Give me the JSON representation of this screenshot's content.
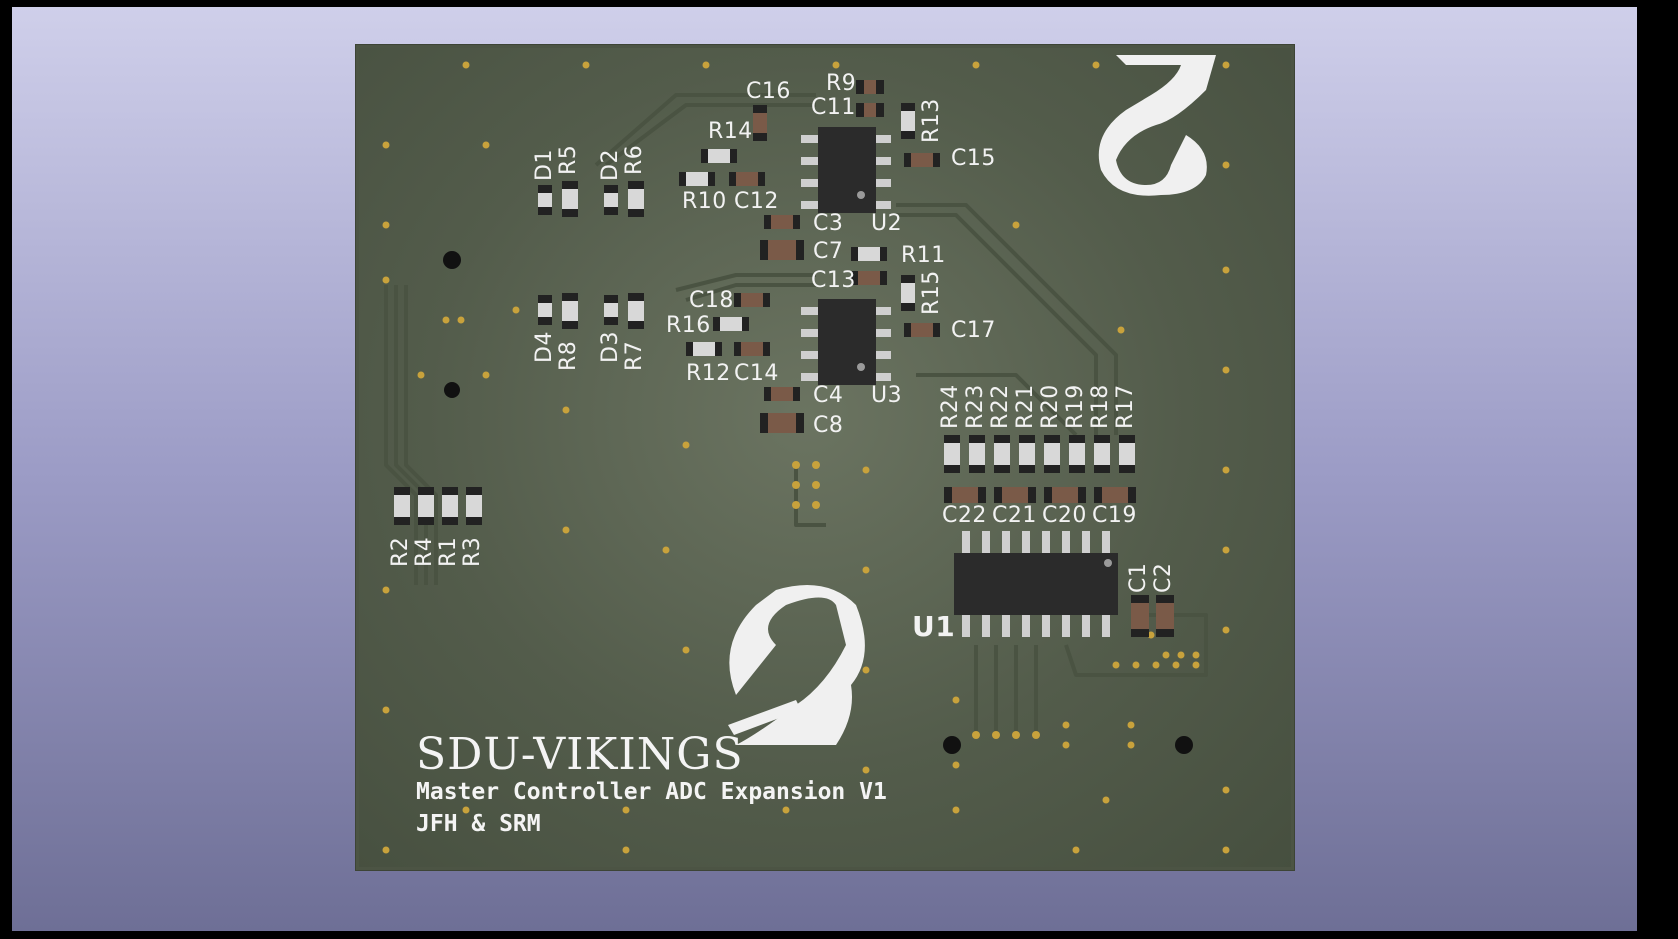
{
  "board": {
    "brand": "SDU-VIKINGS",
    "title": "Master Controller ADC Expansion V1",
    "authors": "JFH & SRM"
  },
  "colors": {
    "background_top": "#cfcfea",
    "background_bottom": "#6e6f96",
    "board": "#5a6350",
    "silkscreen": "#f2f2f2",
    "pad": "#c8a23c",
    "ic_body": "#2b2b2b"
  },
  "labels": {
    "C16": "C16",
    "R9": "R9",
    "C11": "C11",
    "R13": "R13",
    "R14": "R14",
    "C15": "C15",
    "D1": "D1",
    "R5": "R5",
    "D2": "D2",
    "R6": "R6",
    "R10": "R10",
    "C12": "C12",
    "C3": "C3",
    "U2": "U2",
    "C7": "C7",
    "R11": "R11",
    "C13": "C13",
    "R15": "R15",
    "C18": "C18",
    "R16": "R16",
    "C17": "C17",
    "D4": "D4",
    "R8": "R8",
    "D3": "D3",
    "R7": "R7",
    "R12": "R12",
    "C14": "C14",
    "C4": "C4",
    "U3": "U3",
    "C8": "C8",
    "R24": "R24",
    "R23": "R23",
    "R22": "R22",
    "R21": "R21",
    "R20": "R20",
    "R19": "R19",
    "R18": "R18",
    "R17": "R17",
    "C22": "C22",
    "C21": "C21",
    "C20": "C20",
    "C19": "C19",
    "R2": "R2",
    "R4": "R4",
    "R1": "R1",
    "R3": "R3",
    "C1": "C1",
    "C2": "C2",
    "U1": "U1"
  }
}
